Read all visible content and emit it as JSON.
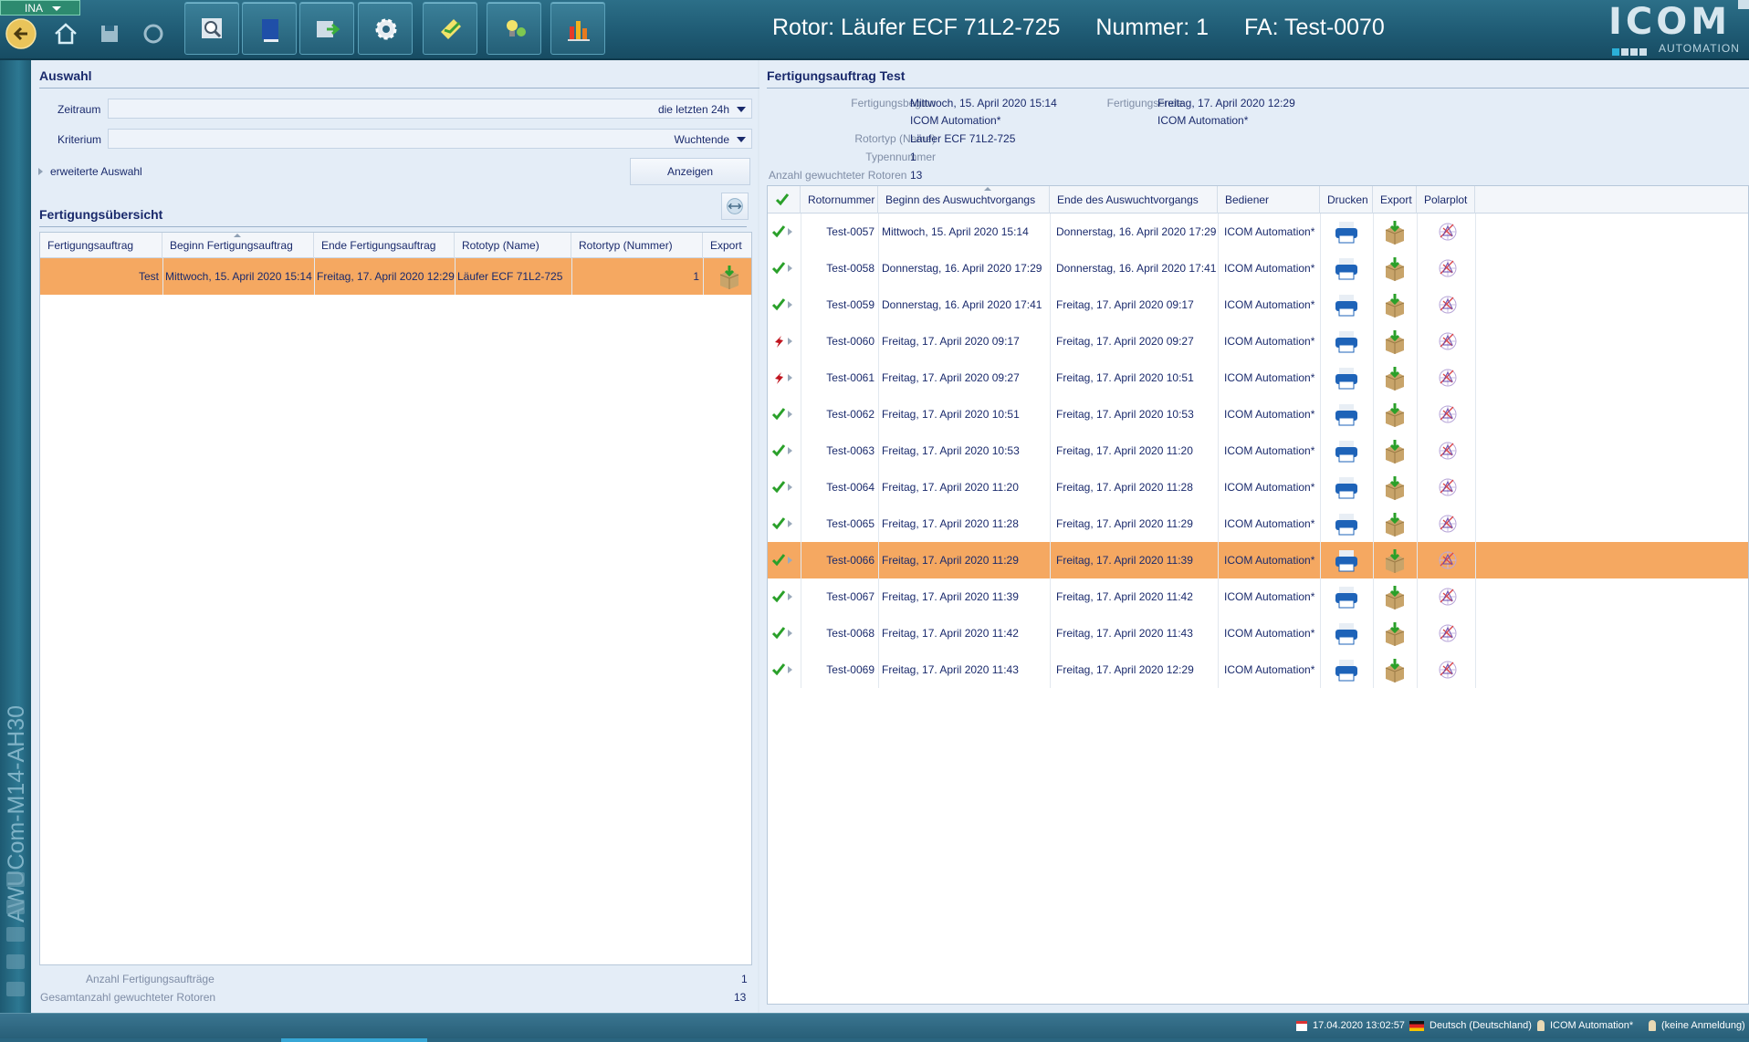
{
  "topbar": {
    "profile": "INA",
    "title_rotor": "Rotor:  Läufer ECF 71L2-725",
    "title_nummer": "Nummer: 1",
    "title_fa": "FA: Test-0070",
    "logo_big": "ICOM",
    "logo_small": "AUTOMATION"
  },
  "leftstrip": {
    "vertical_text": "AWUCom-M14-AH30"
  },
  "auswahl": {
    "title": "Auswahl",
    "zeitraum_label": "Zeitraum",
    "zeitraum_value": "die letzten 24h",
    "kriterium_label": "Kriterium",
    "kriterium_value": "Wuchtende",
    "erweitert_label": "erweiterte Auswahl",
    "anzeigen_label": "Anzeigen"
  },
  "uebersicht": {
    "title": "Fertigungsübersicht",
    "columns": [
      "Fertigungsauftrag",
      "Beginn Fertigungsauftrag",
      "Ende Fertigungsauftrag",
      "Rototyp (Name)",
      "Rotortyp (Nummer)",
      "Export"
    ],
    "rows": [
      {
        "auftrag": "Test",
        "beginn": "Mittwoch, 15. April 2020 15:14",
        "ende": "Freitag, 17. April 2020 12:29",
        "name": "Läufer ECF 71L2-725",
        "nummer": "1"
      }
    ],
    "anzahl_label": "Anzahl Fertigungsaufträge",
    "anzahl_value": "1",
    "gesamt_label": "Gesamtanzahl gewuchteter Rotoren",
    "gesamt_value": "13"
  },
  "detail": {
    "title": "Fertigungsauftrag Test",
    "beginn_label": "Fertigungsbeginn",
    "beginn_value": "Mittwoch, 15. April 2020 15:14",
    "beginn_user": "ICOM Automation*",
    "ende_label": "Fertigungsende",
    "ende_value": "Freitag, 17. April 2020 12:29",
    "ende_user": "ICOM Automation*",
    "rotortyp_label": "Rotortyp (Name)",
    "rotortyp_value": "Läufer ECF 71L2-725",
    "typennummer_label": "Typennummer",
    "typennummer_value": "1",
    "anzahl_label": "Anzahl gewuchteter Rotoren",
    "anzahl_value": "13",
    "columns": [
      "Rotornummer",
      "Beginn des Auswuchtvorgangs",
      "Ende des Auswuchtvorgangs",
      "Bediener",
      "Drucken",
      "Export",
      "Polarplot"
    ],
    "rows": [
      {
        "ok": true,
        "nr": "Test-0057",
        "beginn": "Mittwoch, 15. April 2020 15:14",
        "ende": "Donnerstag, 16. April 2020 17:29",
        "bediener": "ICOM Automation*"
      },
      {
        "ok": true,
        "nr": "Test-0058",
        "beginn": "Donnerstag, 16. April 2020 17:29",
        "ende": "Donnerstag, 16. April 2020 17:41",
        "bediener": "ICOM Automation*"
      },
      {
        "ok": true,
        "nr": "Test-0059",
        "beginn": "Donnerstag, 16. April 2020 17:41",
        "ende": "Freitag, 17. April 2020 09:17",
        "bediener": "ICOM Automation*"
      },
      {
        "ok": false,
        "nr": "Test-0060",
        "beginn": "Freitag, 17. April 2020 09:17",
        "ende": "Freitag, 17. April 2020 09:27",
        "bediener": "ICOM Automation*"
      },
      {
        "ok": false,
        "nr": "Test-0061",
        "beginn": "Freitag, 17. April 2020 09:27",
        "ende": "Freitag, 17. April 2020 10:51",
        "bediener": "ICOM Automation*"
      },
      {
        "ok": true,
        "nr": "Test-0062",
        "beginn": "Freitag, 17. April 2020 10:51",
        "ende": "Freitag, 17. April 2020 10:53",
        "bediener": "ICOM Automation*"
      },
      {
        "ok": true,
        "nr": "Test-0063",
        "beginn": "Freitag, 17. April 2020 10:53",
        "ende": "Freitag, 17. April 2020 11:20",
        "bediener": "ICOM Automation*"
      },
      {
        "ok": true,
        "nr": "Test-0064",
        "beginn": "Freitag, 17. April 2020 11:20",
        "ende": "Freitag, 17. April 2020 11:28",
        "bediener": "ICOM Automation*"
      },
      {
        "ok": true,
        "nr": "Test-0065",
        "beginn": "Freitag, 17. April 2020 11:28",
        "ende": "Freitag, 17. April 2020 11:29",
        "bediener": "ICOM Automation*"
      },
      {
        "ok": true,
        "nr": "Test-0066",
        "beginn": "Freitag, 17. April 2020 11:29",
        "ende": "Freitag, 17. April 2020 11:39",
        "bediener": "ICOM Automation*",
        "selected": true
      },
      {
        "ok": true,
        "nr": "Test-0067",
        "beginn": "Freitag, 17. April 2020 11:39",
        "ende": "Freitag, 17. April 2020 11:42",
        "bediener": "ICOM Automation*"
      },
      {
        "ok": true,
        "nr": "Test-0068",
        "beginn": "Freitag, 17. April 2020 11:42",
        "ende": "Freitag, 17. April 2020 11:43",
        "bediener": "ICOM Automation*"
      },
      {
        "ok": true,
        "nr": "Test-0069",
        "beginn": "Freitag, 17. April 2020 11:43",
        "ende": "Freitag, 17. April 2020 12:29",
        "bediener": "ICOM Automation*"
      }
    ]
  },
  "status": {
    "datetime": "17.04.2020 13:02:57",
    "language": "Deutsch (Deutschland)",
    "user": "ICOM Automation*",
    "login": "(keine Anmeldung)"
  },
  "colors": {
    "selection": "#f5a861",
    "accent": "#2d6f88",
    "text": "#1a2a6c",
    "ok": "#2aa02a",
    "fail": "#c0141e"
  },
  "icons": [
    "back-icon",
    "home-icon",
    "save-icon",
    "sync-icon",
    "search-icon",
    "book-icon",
    "export-icon",
    "gear-icon",
    "notes-icon",
    "bulb-icon",
    "chart-icon",
    "print-icon",
    "box-icon",
    "polarplot-icon",
    "check-icon",
    "fail-icon"
  ]
}
